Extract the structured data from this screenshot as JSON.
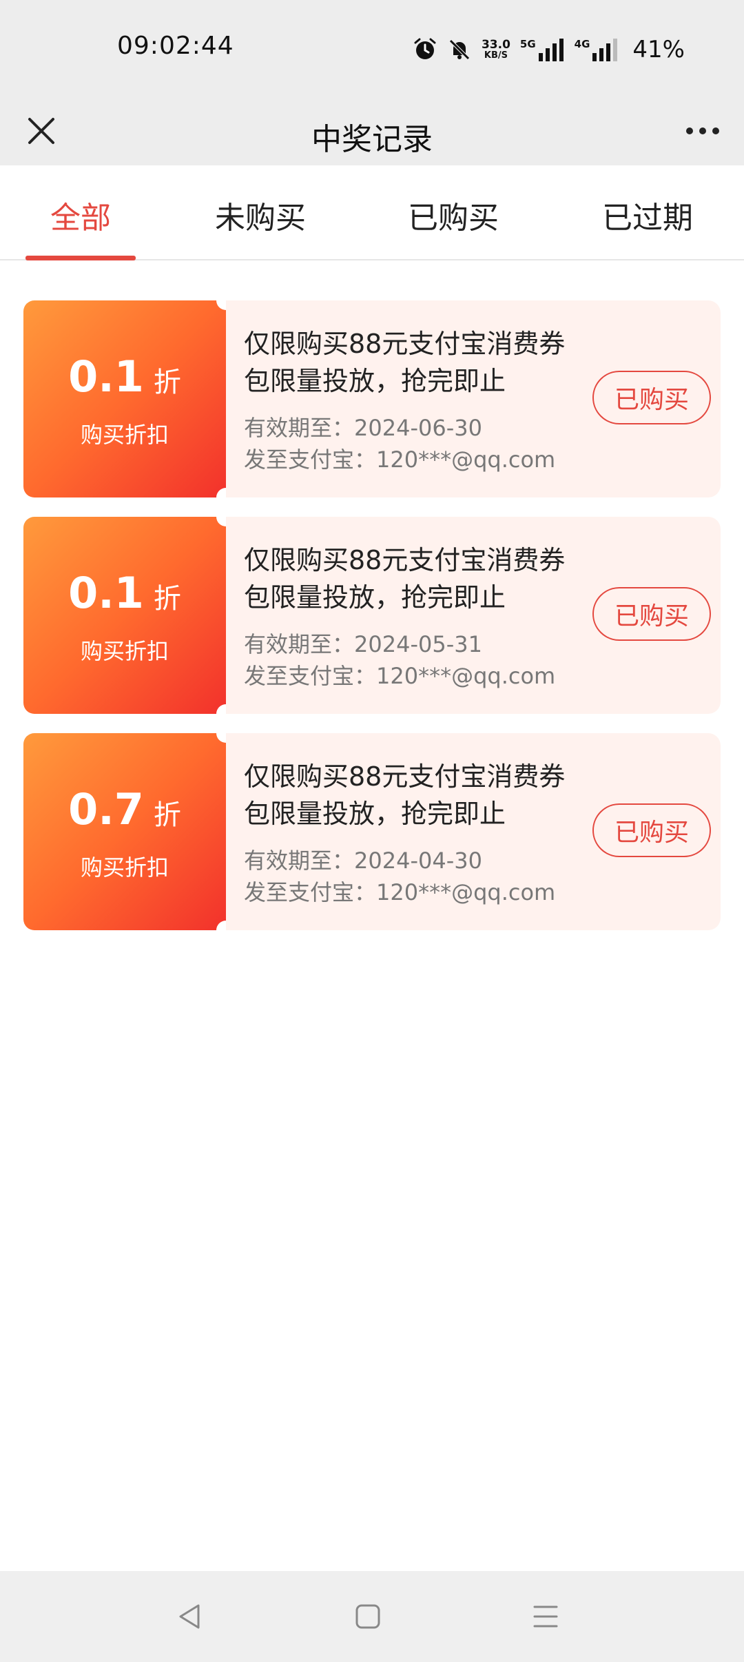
{
  "status_bar": {
    "time": "09:02:44",
    "net_speed": "33.0",
    "net_speed_unit": "KB/S",
    "net1": "5G",
    "net2": "4G",
    "battery": "41%"
  },
  "header": {
    "title": "中奖记录"
  },
  "tabs": [
    {
      "label": "全部",
      "active": true
    },
    {
      "label": "未购买",
      "active": false
    },
    {
      "label": "已购买",
      "active": false
    },
    {
      "label": "已过期",
      "active": false
    }
  ],
  "coupons": [
    {
      "discount": "0.1",
      "unit": "折",
      "label": "购买折扣",
      "title": "仅限购买88元支付宝消费券包限量投放，抢完即止",
      "expire": "有效期至：2024-06-30",
      "send_to": "发至支付宝：120***@qq.com",
      "status": "已购买"
    },
    {
      "discount": "0.1",
      "unit": "折",
      "label": "购买折扣",
      "title": "仅限购买88元支付宝消费券包限量投放，抢完即止",
      "expire": "有效期至：2024-05-31",
      "send_to": "发至支付宝：120***@qq.com",
      "status": "已购买"
    },
    {
      "discount": "0.7",
      "unit": "折",
      "label": "购买折扣",
      "title": "仅限购买88元支付宝消费券包限量投放，抢完即止",
      "expire": "有效期至：2024-04-30",
      "send_to": "发至支付宝：120***@qq.com",
      "status": "已购买"
    }
  ],
  "colors": {
    "accent": "#e4483f",
    "coupon_bg": "#fff2ee",
    "gradient_start": "#ff9a3c",
    "gradient_end": "#f2312c"
  },
  "icons": {
    "close": "close-icon",
    "more": "more-dots-icon",
    "nav_back": "triangle-back-icon",
    "nav_home": "square-home-icon",
    "nav_menu": "menu-lines-icon"
  }
}
